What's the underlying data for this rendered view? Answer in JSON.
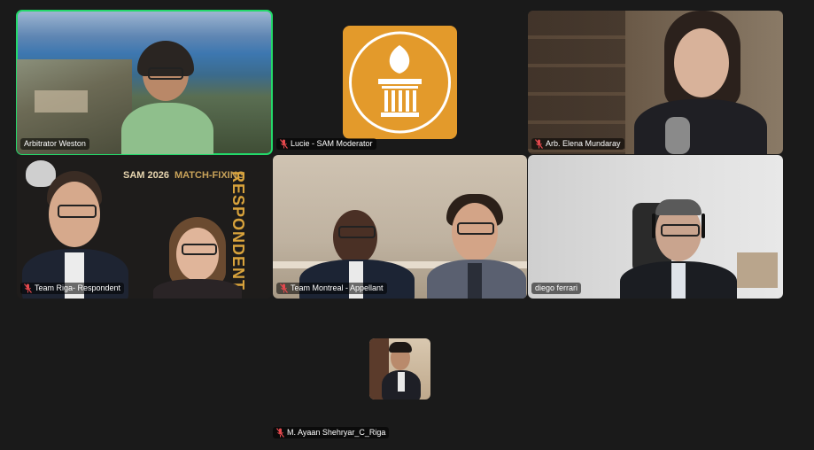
{
  "participants": [
    {
      "name": "Arbitrator Weston",
      "muted": false,
      "active_speaker": true
    },
    {
      "name": "Lucie - SAM Moderator",
      "muted": true,
      "active_speaker": false
    },
    {
      "name": "Arb. Elena Mundaray",
      "muted": true,
      "active_speaker": false
    },
    {
      "name": "Team Riga- Respondent",
      "muted": true,
      "active_speaker": false
    },
    {
      "name": "Team Montreal - Appellant",
      "muted": true,
      "active_speaker": false
    },
    {
      "name": "diego ferrari",
      "muted": false,
      "active_speaker": false
    },
    {
      "name": "M. Ayaan Shehryar_C_Riga",
      "muted": true,
      "active_speaker": false
    }
  ],
  "backdrop": {
    "event": "SAM 2026",
    "topic": "MATCH-FIXING",
    "side": "RESPONDENT"
  },
  "colors": {
    "active_border": "#23d96a",
    "logo_tile": "#e39a2b",
    "muted_icon": "#e5484d"
  }
}
